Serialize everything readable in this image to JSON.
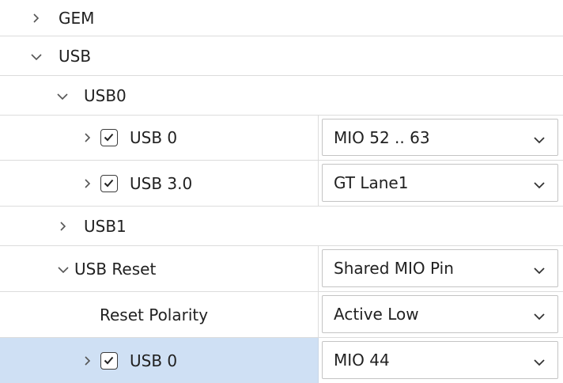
{
  "icons": {
    "collapsed": "chevron-right-icon",
    "expanded": "chevron-down-icon",
    "checkbox": "checkbox-checked-icon",
    "dropdown": "dropdown-caret-icon"
  },
  "colors": {
    "selected_row": "#cfe0f4",
    "divider": "#dcdcdc",
    "text": "#212121"
  },
  "tree": {
    "gem": {
      "label": "GEM",
      "expanded": false
    },
    "usb": {
      "label": "USB",
      "expanded": true
    },
    "usb0_group": {
      "label": "USB0",
      "expanded": true
    },
    "usb0_item": {
      "label": "USB 0",
      "checked": true,
      "value": "MIO 52 .. 63"
    },
    "usb30_item": {
      "label": "USB 3.0",
      "checked": true,
      "value": "GT Lane1"
    },
    "usb1_group": {
      "label": "USB1",
      "expanded": false
    },
    "usb_reset": {
      "label": "USB Reset",
      "expanded": true,
      "value": "Shared MIO Pin"
    },
    "reset_polarity": {
      "label": "Reset Polarity",
      "value": "Active Low"
    },
    "reset_usb0": {
      "label": "USB 0",
      "checked": true,
      "value": "MIO 44",
      "selected": true
    }
  }
}
